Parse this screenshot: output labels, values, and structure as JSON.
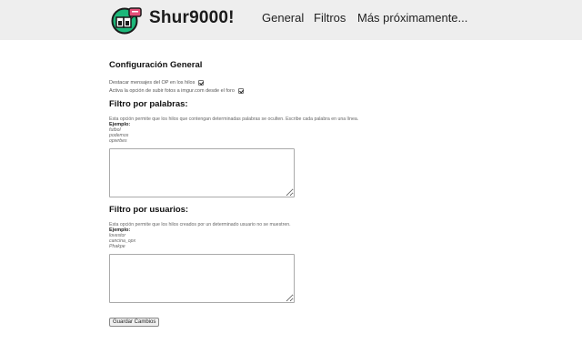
{
  "header": {
    "brand": "Shur9000!",
    "nav": [
      "General",
      "Filtros",
      "Más próximamente..."
    ]
  },
  "general": {
    "title": "Configuración General",
    "options": [
      {
        "label": "Destacar mensajes del OP en los hilos",
        "checked": true
      },
      {
        "label": "Activa la opción de subir fotos a imgur.com desde el foro",
        "checked": true
      }
    ]
  },
  "word_filter": {
    "title": "Filtro por palabras:",
    "description": "Esta opción permite que los hilos que contengan determinadas palabras se oculten. Escribe cada palabra en una línea.",
    "example_label": "Ejemplo:",
    "examples": [
      "futbol",
      "podemos",
      "opwrbes"
    ],
    "value": ""
  },
  "user_filter": {
    "title": "Filtro por usuarios:",
    "description": "Esta opción permite que los hilos creados por un determinado usuario no se muestren.",
    "example_label": "Ejemplo:",
    "examples": [
      "lovestor",
      "cancina_opx",
      "Phakpe"
    ],
    "value": ""
  },
  "save_label": "Guardar Cambios",
  "colors": {
    "header_bg": "#eeeeee",
    "logo_green": "#1db87a",
    "logo_pink": "#e8507a"
  }
}
